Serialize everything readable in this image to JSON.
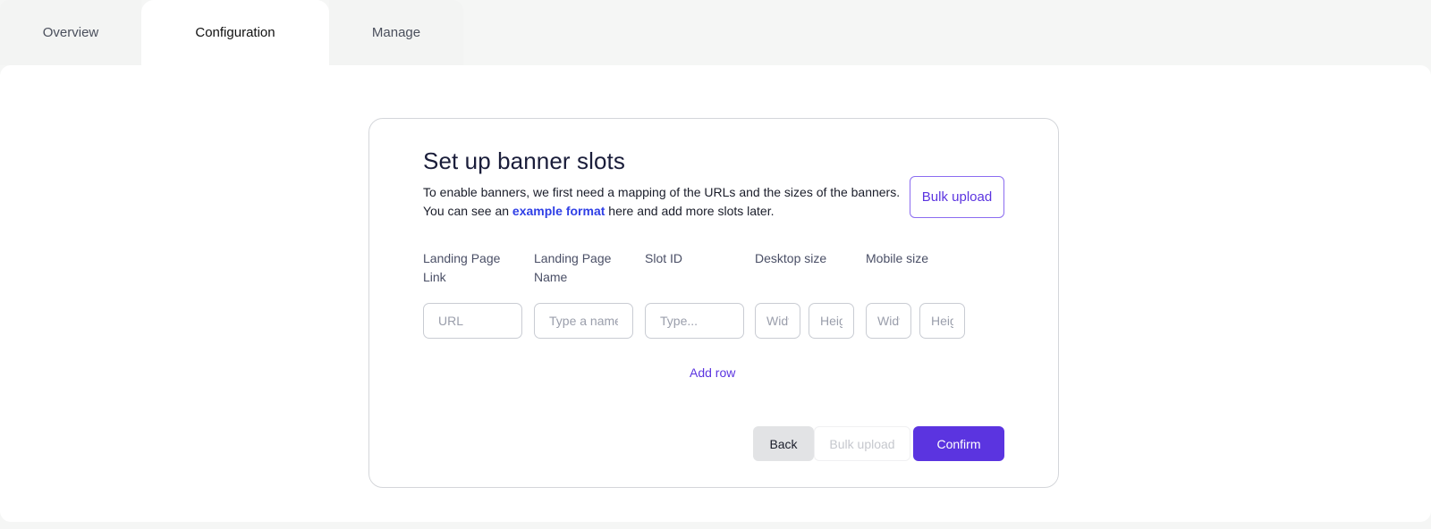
{
  "tabs": {
    "overview": "Overview",
    "configuration": "Configuration",
    "manage": "Manage"
  },
  "card": {
    "title": "Set up banner slots",
    "desc_line1": "To enable banners, we first need a mapping of the URLs and the sizes of the banners.",
    "desc_line2_before": "You can see an ",
    "desc_link": "example format",
    "desc_line2_after": " here and add more slots later.",
    "bulk_upload": "Bulk upload"
  },
  "columns": {
    "landing_page_link": "Landing Page Link",
    "landing_page_name": "Landing Page Name",
    "slot_id": "Slot ID",
    "desktop_size": "Desktop size",
    "mobile_size": "Mobile size"
  },
  "placeholders": {
    "url": "URL",
    "name": "Type a name",
    "slot": "Type...",
    "desktop_w": "Width",
    "desktop_h": "Height",
    "mobile_w": "Width",
    "mobile_h": "Height"
  },
  "add_row": "Add row",
  "buttons": {
    "back": "Back",
    "bulk_upload": "Bulk upload",
    "confirm": "Confirm"
  },
  "colors": {
    "accent": "#5b34e0",
    "link": "#2f3fe6"
  }
}
